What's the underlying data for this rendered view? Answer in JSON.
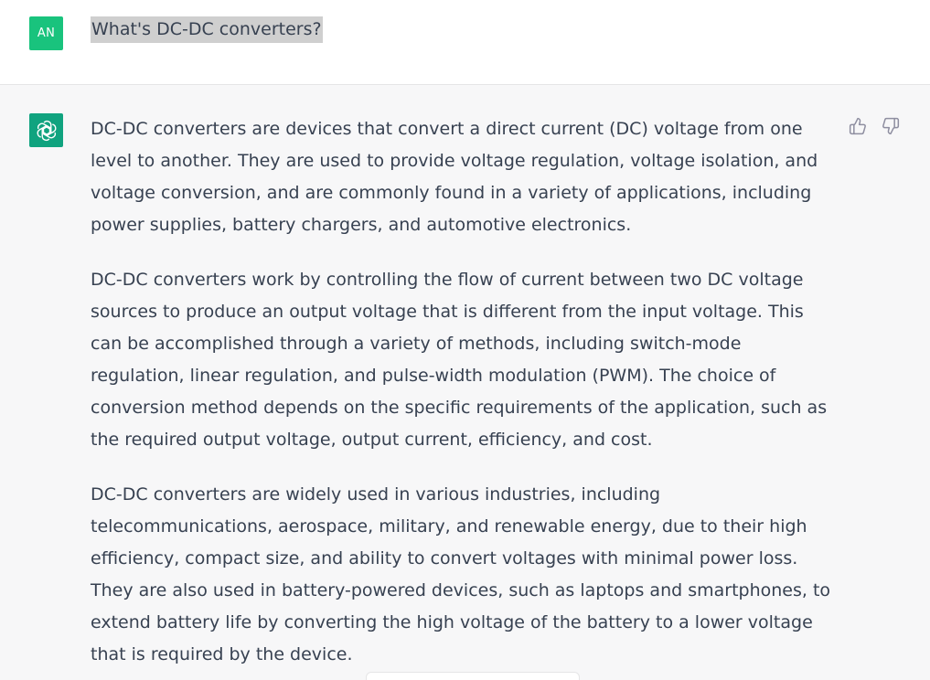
{
  "user": {
    "avatar_initials": "AN",
    "avatar_color": "#19c37d",
    "highlight_color": "#cfcfcf",
    "message": "What's DC-DC converters?"
  },
  "assistant": {
    "avatar_icon": "openai-logo-icon",
    "avatar_color": "#10a37f",
    "paragraphs": [
      "DC-DC converters are devices that convert a direct current (DC) voltage from one\nlevel to another. They are used to provide voltage regulation, voltage isolation, and\nvoltage conversion, and are commonly found in a variety of applications, including\npower supplies, battery chargers, and automotive electronics.",
      "DC-DC converters work by controlling the flow of current between two DC voltage\nsources to produce an output voltage that is different from the input voltage. This\ncan be accomplished through a variety of methods, including switch-mode\nregulation, linear regulation, and pulse-width modulation (PWM). The choice of\nconversion method depends on the specific requirements of the application, such as\nthe required output voltage, output current, efficiency, and cost.",
      "DC-DC converters are widely used in various industries, including\ntelecommunications, aerospace, military, and renewable energy, due to their high\nefficiency, compact size, and ability to convert voltages with minimal power loss.\nThey are also used in battery-powered devices, such as laptops and smartphones, to\nextend battery life by converting the high voltage of the battery to a lower voltage\nthat is required by the device."
    ],
    "feedback_icons": [
      "thumbs-up-icon",
      "thumbs-down-icon"
    ]
  }
}
